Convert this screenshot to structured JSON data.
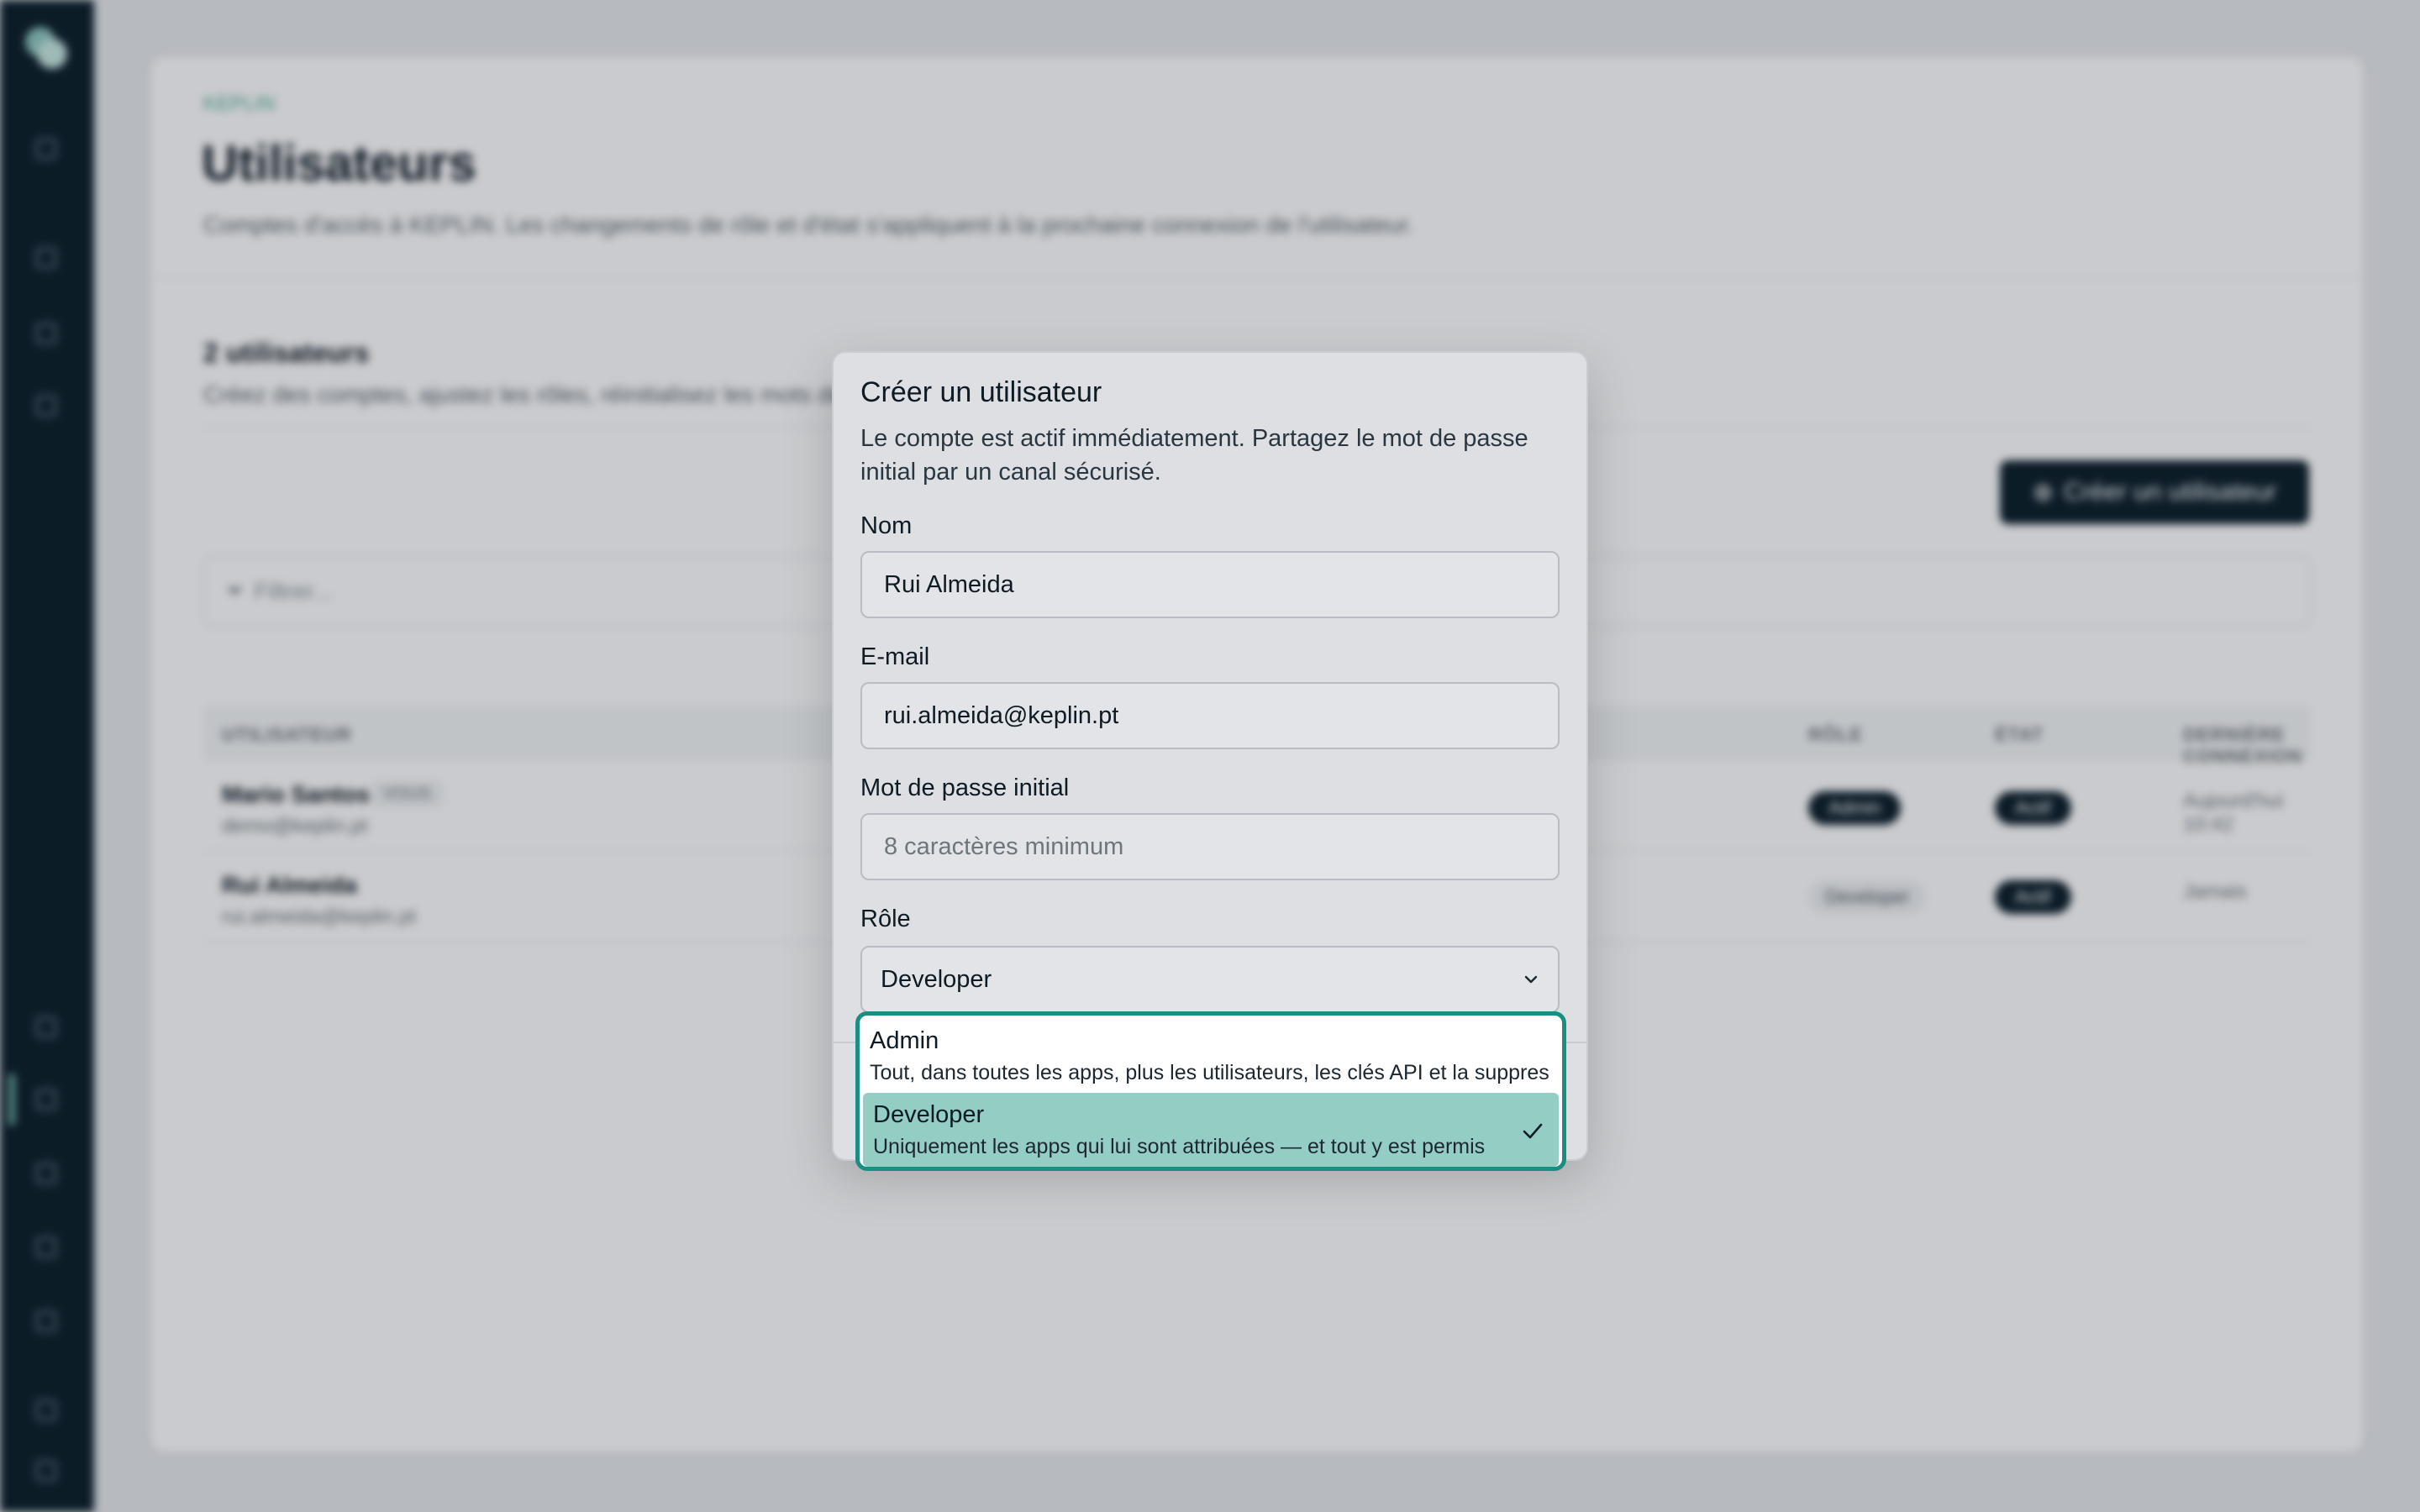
{
  "app": {
    "breadcrumb": "KEPLIN",
    "title": "Utilisateurs",
    "description": "Comptes d'accès à KEPLIN. Les changements de rôle et d'état s'appliquent à la prochaine connexion de l'utilisateur.",
    "section_title": "2 utilisateurs",
    "section_desc": "Créez des comptes, ajustez les rôles, réinitialisez les mots de passe.",
    "create_button": "Créer un utilisateur",
    "filter_placeholder": "Filtrer...",
    "columns": [
      "UTILISATEUR",
      "RÔLE",
      "ÉTAT",
      "DERNIÈRE CONNEXION"
    ],
    "rows": [
      {
        "name": "Mario Santos",
        "badge": "VOUS",
        "email": "demo@keplin.pt",
        "role": "Admin",
        "state": "Actif",
        "last_login": "Aujourd'hui 10:42"
      },
      {
        "name": "Rui Almeida",
        "email": "rui.almeida@keplin.pt",
        "role": "Developer",
        "state": "Actif",
        "last_login": "Jamais"
      }
    ]
  },
  "dialog": {
    "title": "Créer un utilisateur",
    "description": "Le compte est actif immédiatement. Partagez le mot de passe initial par un canal sécurisé.",
    "name_label": "Nom",
    "name_value": "Rui Almeida",
    "email_label": "E-mail",
    "email_value": "rui.almeida@keplin.pt",
    "password_label": "Mot de passe initial",
    "password_placeholder": "8 caractères minimum",
    "role_label": "Rôle",
    "role_value": "Developer"
  },
  "dropdown": {
    "options": [
      {
        "name": "Admin",
        "description": "Tout, dans toutes les apps, plus les utilisateurs, les clés API et la suppres"
      },
      {
        "name": "Developer",
        "description": "Uniquement les apps qui lui sont attribuées — et tout y est permis",
        "selected": true
      }
    ]
  },
  "colors": {
    "sidebar": "#0c1f2a",
    "accent": "#1a8e82",
    "selected_option": "#94cdc4"
  }
}
